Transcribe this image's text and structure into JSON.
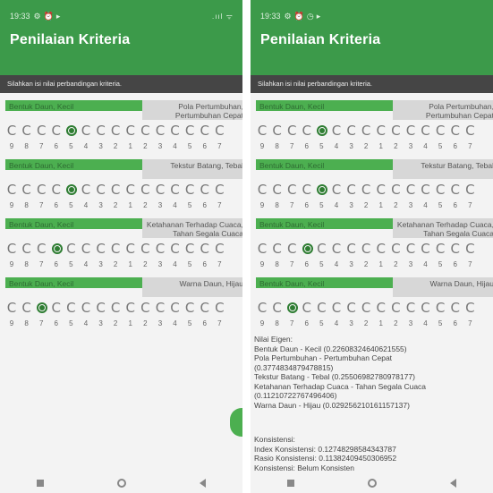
{
  "status": {
    "time": "19:33",
    "signal": ".ııl ᯤ"
  },
  "app": {
    "title": "Penilaian Kriteria"
  },
  "instruction": "Silahkan isi nilai perbandingan kriteria.",
  "scale": [
    "9",
    "8",
    "7",
    "6",
    "5",
    "4",
    "3",
    "2",
    "1",
    "2",
    "3",
    "4",
    "5",
    "6",
    "7"
  ],
  "criteria_left": [
    {
      "left": "Bentuk Daun, Kecil",
      "right1": "Pola Pertumbuhan,",
      "right2": "Pertumbuhan Cepat",
      "selected": 4
    },
    {
      "left": "Bentuk Daun, Kecil",
      "right1": "Tekstur Batang, Tebal",
      "right2": "",
      "selected": 4
    },
    {
      "left": "Bentuk Daun, Kecil",
      "right1": "Ketahanan Terhadap Cuaca,",
      "right2": "Tahan Segala Cuaca",
      "selected": 3
    },
    {
      "left": "Bentuk Daun, Kecil",
      "right1": "Warna Daun, Hijau",
      "right2": "",
      "selected": 2
    }
  ],
  "criteria_right": [
    {
      "left": "Bentuk Daun, Kecil",
      "right1": "Pola Pertumbuhan,",
      "right2": "Pertumbuhan Cepat",
      "selected": 4
    },
    {
      "left": "Bentuk Daun, Kecil",
      "right1": "Tekstur Batang, Tebal",
      "right2": "",
      "selected": 4
    },
    {
      "left": "Bentuk Daun, Kecil",
      "right1": "Ketahanan Terhadap Cuaca,",
      "right2": "Tahan Segala Cuaca",
      "selected": 3
    },
    {
      "left": "Bentuk Daun, Kecil",
      "right1": "Warna Daun, Hijau",
      "right2": "",
      "selected": 2
    }
  ],
  "results": {
    "eigen": "Nilai Eigen:\nBentuk Daun - Kecil (0.22608324640621555)\nPola Pertumbuhan - Pertumbuhan Cepat\n(0.3774834879478815)\nTekstur Batang - Tebal (0.25506982780978177)\nKetahanan Terhadap Cuaca - Tahan Segala Cuaca\n(0.11210722767496406)\nWarna Daun - Hijau (0.029256210161157137)",
    "konsistensi": "Konsistensi:\nIndex Konsistensi: 0.12748298584343787\nRasio Konsistensi: 0.11382409450306952\nKonsistensi: Belum Konsisten"
  },
  "colors": {
    "appbar": "#3c9a4a",
    "accent": "#4caf50",
    "radio_selected": "#2e7d32"
  }
}
